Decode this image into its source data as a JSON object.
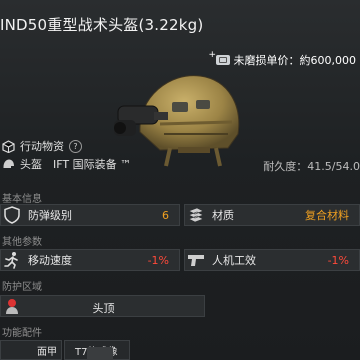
{
  "item": {
    "title": "IND50重型战术头盔(3.22kg)",
    "price": "未磨损单价：約600,000",
    "durability": "耐久度：41.5/54.0"
  },
  "tags": {
    "action_label": "行动物资",
    "help_glyph": "?",
    "type_label": "头盔",
    "brand_label": "IFT 国际装备 ™"
  },
  "sections": {
    "basic": "基本信息",
    "other": "其他参数",
    "protect": "防护区域",
    "attach": "功能配件"
  },
  "stats": {
    "armor_level_label": "防弹级别",
    "armor_level_value": "6",
    "material_label": "材质",
    "material_value": "复合材料",
    "move_speed_label": "移动速度",
    "move_speed_value": "-1%",
    "ergonomics_label": "人机工效",
    "ergonomics_value": "-1%"
  },
  "zone": {
    "label": "头顶"
  },
  "attachments": [
    {
      "label": "面甲"
    },
    {
      "label": "T7热成像"
    }
  ],
  "colors": {
    "highlight": "#f0a020",
    "negative": "#ff4a3a",
    "helmet_tan": "#a08a4a"
  }
}
